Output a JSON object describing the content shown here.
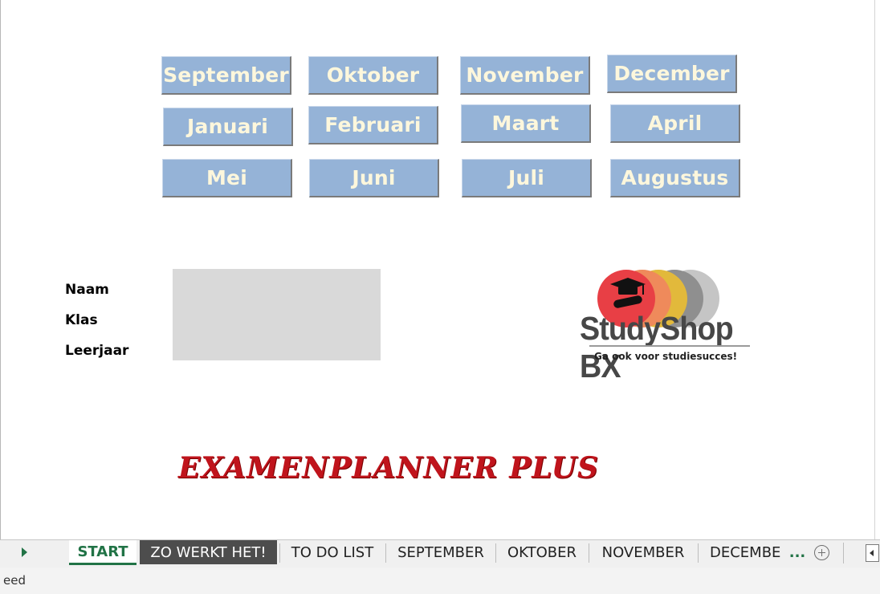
{
  "months": [
    "September",
    "Oktober",
    "November",
    "December",
    "Januari",
    "Februari",
    "Maart",
    "April",
    "Mei",
    "Juni",
    "Juli",
    "Augustus"
  ],
  "fields": {
    "naam": "Naam",
    "klas": "Klas",
    "leerjaar": "Leerjaar"
  },
  "logo": {
    "name": "StudyShop BX",
    "tagline": "Ga ook voor studiesucces!"
  },
  "title": "EXAMENPLANNER PLUS",
  "tabs": [
    "START",
    "ZO WERKT HET!",
    "TO DO LIST",
    "SEPTEMBER",
    "OKTOBER",
    "NOVEMBER",
    "DECEMBE",
    "..."
  ],
  "status": {
    "text": "eed"
  },
  "colors": {
    "month_button": "#95b3d7",
    "month_text": "#fdf7dc",
    "title": "#c0141c",
    "active_tab": "#217346",
    "dark_tab": "#4d4d4d"
  },
  "icons": {
    "add_sheet": "plus-circle-icon",
    "scroll_right": "arrow-right-icon",
    "scroll_left": "arrow-left-icon"
  }
}
